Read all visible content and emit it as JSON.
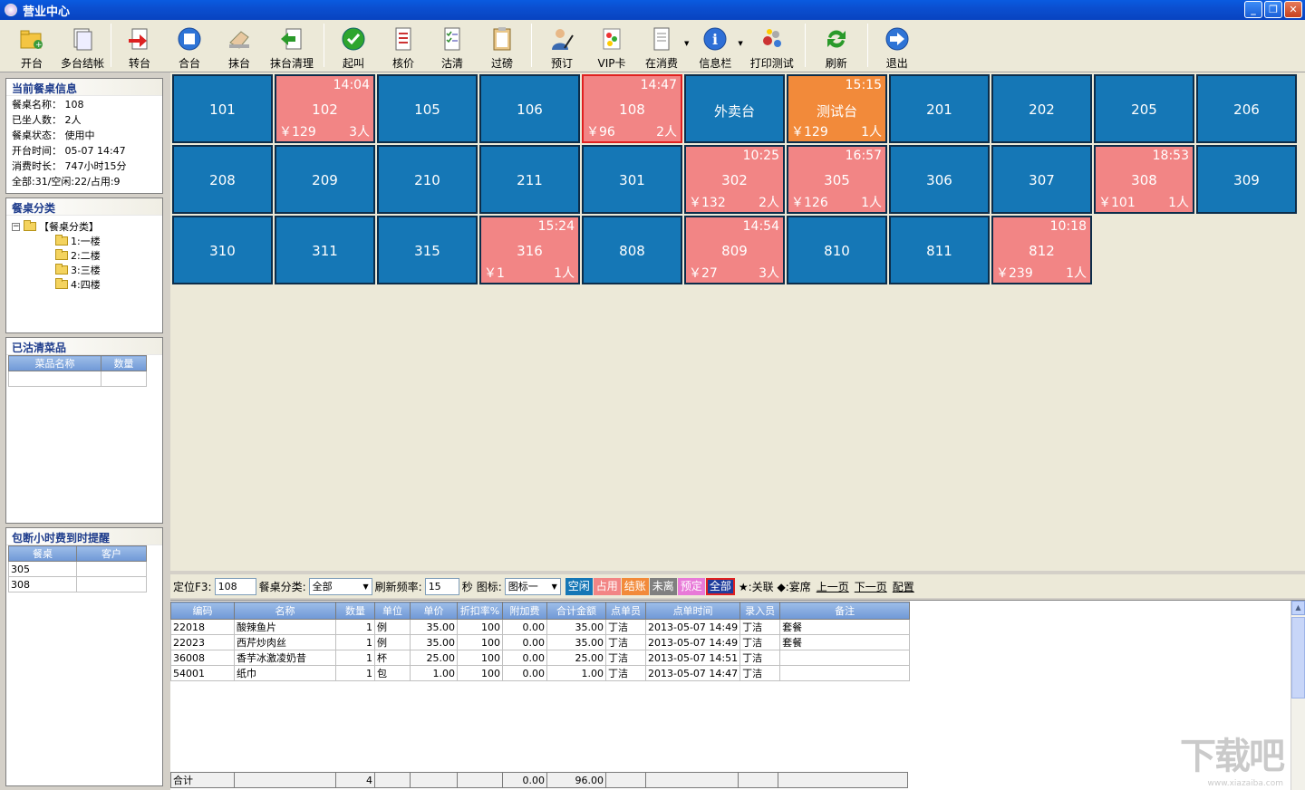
{
  "window": {
    "title": "营业中心"
  },
  "toolbar": [
    {
      "label": "开台",
      "icon": "folder-open-icon"
    },
    {
      "label": "多台结帐",
      "icon": "documents-icon"
    },
    {
      "sep": true
    },
    {
      "label": "转台",
      "icon": "transfer-icon"
    },
    {
      "label": "合台",
      "icon": "merge-icon"
    },
    {
      "label": "抹台",
      "icon": "wipe-hand-icon"
    },
    {
      "label": "抹台清理",
      "icon": "clean-arrow-icon"
    },
    {
      "sep": true
    },
    {
      "label": "起叫",
      "icon": "checkmark-icon"
    },
    {
      "label": "核价",
      "icon": "list-doc-icon"
    },
    {
      "label": "沽清",
      "icon": "checklist-icon"
    },
    {
      "label": "过磅",
      "icon": "clipboard-icon"
    },
    {
      "sep": true
    },
    {
      "label": "预订",
      "icon": "person-pen-icon"
    },
    {
      "label": "VIP卡",
      "icon": "vip-card-icon"
    },
    {
      "label": "在消费",
      "icon": "document-icon",
      "dropdown": true
    },
    {
      "label": "信息栏",
      "icon": "info-icon",
      "dropdown": true
    },
    {
      "label": "打印测试",
      "icon": "printer-gears-icon"
    },
    {
      "sep": true
    },
    {
      "label": "刷新",
      "icon": "refresh-icon"
    },
    {
      "sep": true
    },
    {
      "label": "退出",
      "icon": "exit-arrow-icon"
    }
  ],
  "current_table": {
    "title": "当前餐桌信息",
    "lines": [
      "餐桌名称： 108",
      "已坐人数： 2人",
      "餐桌状态： 使用中",
      "开台时间： 05-07 14:47",
      "消费时长： 747小时15分",
      "全部:31/空闲:22/占用:9"
    ]
  },
  "category": {
    "title": "餐桌分类",
    "root": "【餐桌分类】",
    "items": [
      "1:一楼",
      "2:二楼",
      "3:三楼",
      "4:四楼"
    ]
  },
  "soldout": {
    "title": "已沽清菜品",
    "headers": [
      "菜品名称",
      "数量"
    ]
  },
  "reminder": {
    "title": "包断小时费到时提醒",
    "headers": [
      "餐桌",
      "客户"
    ],
    "rows": [
      [
        "305",
        ""
      ],
      [
        "308",
        ""
      ]
    ]
  },
  "tables": [
    {
      "name": "101",
      "status": "free"
    },
    {
      "name": "102",
      "status": "occupied",
      "time": "14:04",
      "amount": "￥129",
      "people": "3人"
    },
    {
      "name": "105",
      "status": "free"
    },
    {
      "name": "106",
      "status": "free"
    },
    {
      "name": "108",
      "status": "occupied",
      "selected": true,
      "time": "14:47",
      "amount": "￥96",
      "people": "2人"
    },
    {
      "name": "外卖台",
      "status": "free"
    },
    {
      "name": "测试台",
      "status": "orange",
      "time": "15:15",
      "amount": "￥129",
      "people": "1人"
    },
    {
      "name": "201",
      "status": "free"
    },
    {
      "name": "202",
      "status": "free"
    },
    {
      "name": "205",
      "status": "free"
    },
    {
      "name": "206",
      "status": "free"
    },
    {
      "name": "208",
      "status": "free"
    },
    {
      "name": "209",
      "status": "free"
    },
    {
      "name": "210",
      "status": "free"
    },
    {
      "name": "211",
      "status": "free"
    },
    {
      "name": "301",
      "status": "free"
    },
    {
      "name": "302",
      "status": "occupied",
      "time": "10:25",
      "amount": "￥132",
      "people": "2人"
    },
    {
      "name": "305",
      "status": "occupied",
      "time": "16:57",
      "amount": "￥126",
      "people": "1人"
    },
    {
      "name": "306",
      "status": "free"
    },
    {
      "name": "307",
      "status": "free"
    },
    {
      "name": "308",
      "status": "occupied",
      "time": "18:53",
      "amount": "￥101",
      "people": "1人"
    },
    {
      "name": "309",
      "status": "free"
    },
    {
      "name": "310",
      "status": "free"
    },
    {
      "name": "311",
      "status": "free"
    },
    {
      "name": "315",
      "status": "free"
    },
    {
      "name": "316",
      "status": "occupied",
      "time": "15:24",
      "amount": "￥1",
      "people": "1人"
    },
    {
      "name": "808",
      "status": "free"
    },
    {
      "name": "809",
      "status": "occupied",
      "time": "14:54",
      "amount": "￥27",
      "people": "3人"
    },
    {
      "name": "810",
      "status": "free"
    },
    {
      "name": "811",
      "status": "free"
    },
    {
      "name": "812",
      "status": "occupied",
      "time": "10:18",
      "amount": "￥239",
      "people": "1人"
    }
  ],
  "filter": {
    "locate_label": "定位F3:",
    "locate_value": "108",
    "category_label": "餐桌分类:",
    "category_value": "全部",
    "refresh_label": "刷新频率:",
    "refresh_value": "15",
    "seconds_label": "秒",
    "icon_label": "图标:",
    "icon_value": "图标一",
    "chips": [
      {
        "label": "空闲",
        "color": "#1577b6"
      },
      {
        "label": "占用",
        "color": "#f28585"
      },
      {
        "label": "结账",
        "color": "#f28a3a"
      },
      {
        "label": "未离",
        "color": "#808080"
      },
      {
        "label": "预定",
        "color": "#e87ad8"
      },
      {
        "label": "全部",
        "color": "#1f3c9c"
      }
    ],
    "legend": "★:关联 ◆:宴席",
    "prev": "上一页",
    "next": "下一页",
    "config": "配置"
  },
  "orders": {
    "headers": [
      "编码",
      "名称",
      "数量",
      "单位",
      "单价",
      "折扣率%",
      "附加费",
      "合计金额",
      "点单员",
      "点单时间",
      "录入员",
      "备注"
    ],
    "rows": [
      [
        "22018",
        "酸辣鱼片",
        "1",
        "例",
        "35.00",
        "100",
        "0.00",
        "35.00",
        "丁洁",
        "2013-05-07 14:49",
        "丁洁",
        "套餐"
      ],
      [
        "22023",
        "西芹炒肉丝",
        "1",
        "例",
        "35.00",
        "100",
        "0.00",
        "35.00",
        "丁洁",
        "2013-05-07 14:49",
        "丁洁",
        "套餐"
      ],
      [
        "36008",
        "香芋冰激凌奶昔",
        "1",
        "杯",
        "25.00",
        "100",
        "0.00",
        "25.00",
        "丁洁",
        "2013-05-07 14:51",
        "丁洁",
        ""
      ],
      [
        "54001",
        "纸巾",
        "1",
        "包",
        "1.00",
        "100",
        "0.00",
        "1.00",
        "丁洁",
        "2013-05-07 14:47",
        "丁洁",
        ""
      ]
    ],
    "footer": [
      "合计",
      "",
      "4",
      "",
      "",
      "",
      "0.00",
      "96.00",
      "",
      "",
      "",
      ""
    ]
  },
  "watermark": {
    "text": "下载吧",
    "sub": "www.xiazaiba.com"
  }
}
